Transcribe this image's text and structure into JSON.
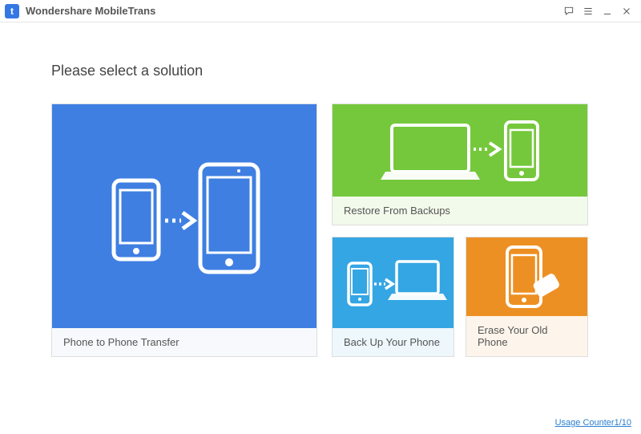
{
  "app": {
    "title": "Wondershare MobileTrans",
    "logo_letter": "t"
  },
  "heading": "Please select a solution",
  "tiles": {
    "transfer": {
      "label": "Phone to Phone Transfer"
    },
    "restore": {
      "label": "Restore From Backups"
    },
    "backup": {
      "label": "Back Up Your Phone"
    },
    "erase": {
      "label": "Erase Your Old Phone"
    }
  },
  "footer": {
    "usage_counter": "Usage Counter1/10"
  },
  "colors": {
    "blue": "#3f7fe2",
    "green": "#75c83c",
    "lightblue": "#34a6e4",
    "orange": "#ed9023"
  }
}
